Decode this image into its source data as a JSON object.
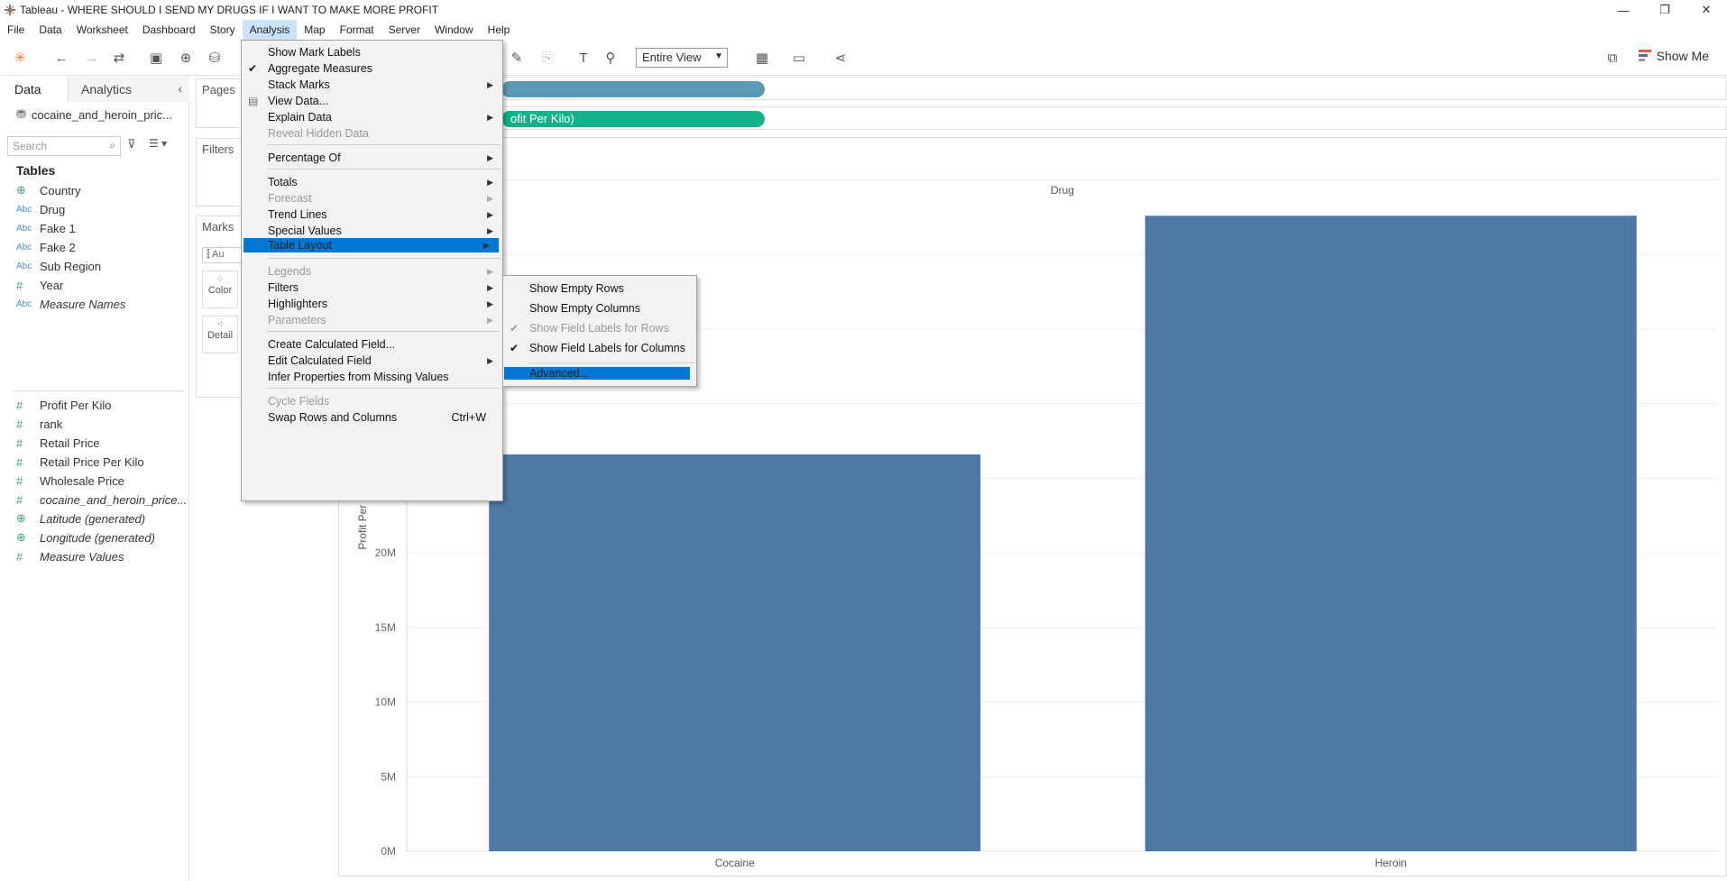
{
  "window": {
    "title": "Tableau - WHERE SHOULD I SEND MY DRUGS IF I WANT TO MAKE MORE PROFIT",
    "minimize": "—",
    "restore": "❐",
    "close": "✕"
  },
  "menubar": [
    "File",
    "Data",
    "Worksheet",
    "Dashboard",
    "Story",
    "Analysis",
    "Map",
    "Format",
    "Server",
    "Window",
    "Help"
  ],
  "toolbar": {
    "fit_select": "Entire View",
    "show_me": "Show Me"
  },
  "data_pane": {
    "tab_data": "Data",
    "tab_analytics": "Analytics",
    "datasource": "cocaine_and_heroin_pric...",
    "search_placeholder": "Search",
    "tables_header": "Tables",
    "dimensions": [
      {
        "icon": "geo",
        "name": "Country",
        "italic": false
      },
      {
        "icon": "abc",
        "name": "Drug",
        "italic": false
      },
      {
        "icon": "abc",
        "name": "Fake 1",
        "italic": false
      },
      {
        "icon": "abc",
        "name": "Fake 2",
        "italic": false
      },
      {
        "icon": "abc",
        "name": "Sub Region",
        "italic": false
      },
      {
        "icon": "num",
        "name": "Year",
        "italic": false
      },
      {
        "icon": "abc",
        "name": "Measure Names",
        "italic": true
      }
    ],
    "measures": [
      {
        "icon": "num",
        "name": "Profit Per Kilo",
        "italic": false
      },
      {
        "icon": "num",
        "name": "rank",
        "italic": false
      },
      {
        "icon": "num",
        "name": "Retail Price",
        "italic": false
      },
      {
        "icon": "num",
        "name": "Retail Price Per Kilo",
        "italic": false
      },
      {
        "icon": "num",
        "name": "Wholesale Price",
        "italic": false
      },
      {
        "icon": "num",
        "name": "cocaine_and_heroin_price...",
        "italic": true
      },
      {
        "icon": "geo",
        "name": "Latitude (generated)",
        "italic": true
      },
      {
        "icon": "geo",
        "name": "Longitude (generated)",
        "italic": true
      },
      {
        "icon": "num",
        "name": "Measure Values",
        "italic": true
      }
    ]
  },
  "cards": {
    "pages": "Pages",
    "filters": "Filters",
    "marks": "Marks",
    "marks_type": "Au",
    "color": "Color",
    "detail": "Detail"
  },
  "shelves": {
    "rows_pill": "ofit Per Kilo)"
  },
  "analysis_menu": {
    "items": [
      {
        "label": "Show Mark Labels"
      },
      {
        "label": "Aggregate Measures",
        "check": true
      },
      {
        "label": "Stack Marks",
        "sub": true
      },
      {
        "label": "View Data...",
        "icon": true
      },
      {
        "label": "Explain Data",
        "sub": true
      },
      {
        "label": "Reveal Hidden Data",
        "disabled": true
      },
      {
        "sep": true
      },
      {
        "label": "Percentage Of",
        "sub": true
      },
      {
        "sep": true
      },
      {
        "label": "Totals",
        "sub": true
      },
      {
        "label": "Forecast",
        "sub": true,
        "disabled": true
      },
      {
        "label": "Trend Lines",
        "sub": true
      },
      {
        "label": "Special Values",
        "sub": true
      },
      {
        "label": "Table Layout",
        "sub": true,
        "highlight": true
      },
      {
        "sep": true
      },
      {
        "label": "Legends",
        "sub": true,
        "disabled": true
      },
      {
        "label": "Filters",
        "sub": true
      },
      {
        "label": "Highlighters",
        "sub": true
      },
      {
        "label": "Parameters",
        "sub": true,
        "disabled": true
      },
      {
        "sep": true
      },
      {
        "label": "Create Calculated Field..."
      },
      {
        "label": "Edit Calculated Field",
        "sub": true
      },
      {
        "label": "Infer Properties from Missing Values"
      },
      {
        "sep": true
      },
      {
        "label": "Cycle Fields",
        "disabled": true
      },
      {
        "label": "Swap Rows and Columns",
        "shortcut": "Ctrl+W"
      }
    ]
  },
  "table_layout_menu": {
    "items": [
      {
        "label": "Show Empty Rows"
      },
      {
        "label": "Show Empty Columns"
      },
      {
        "label": "Show Field Labels for Rows",
        "check": true,
        "disabled": true
      },
      {
        "label": "Show Field Labels for Columns",
        "check": true
      },
      {
        "sep": true
      },
      {
        "label": "Advanced...",
        "highlight": true
      }
    ]
  },
  "chart_data": {
    "type": "bar",
    "title": "Drug",
    "categories": [
      "Cocaine",
      "Heroin"
    ],
    "values": [
      26600000,
      42600000
    ],
    "ylabel": "Profit Per Kilo",
    "ylim": [
      0,
      46000000
    ],
    "yticks": [
      0,
      5000000,
      10000000,
      15000000,
      20000000
    ],
    "ytick_labels": [
      "0M",
      "5M",
      "10M",
      "15M",
      "20M"
    ],
    "bar_color": "#4e79a7",
    "grid": true
  }
}
